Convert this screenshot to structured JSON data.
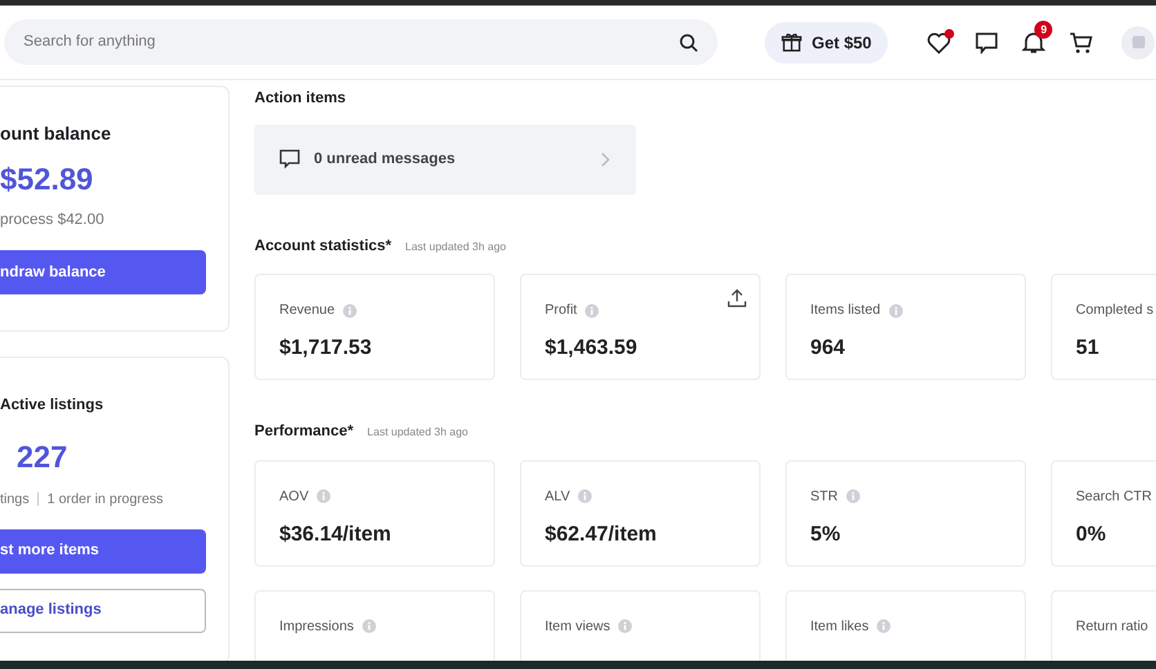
{
  "header": {
    "search": {
      "placeholder": "Search for anything"
    },
    "promo": "Get $50",
    "favorites_dot": true,
    "notifications": "9"
  },
  "balance_card": {
    "title": "ount balance",
    "amount": "$52.89",
    "in_process": "process $42.00",
    "button": "ndraw balance"
  },
  "listings_card": {
    "title": "Active listings",
    "count": "227",
    "stats": [
      "tings",
      "1 order in progress"
    ],
    "buttons": [
      {
        "label": "st more items",
        "kind": "primary"
      },
      {
        "label": "anage listings",
        "kind": "outline"
      }
    ]
  },
  "action_items": {
    "title": "Action items",
    "items": [
      {
        "label": "0 unread messages"
      }
    ]
  },
  "sections": [
    {
      "title": "Account statistics*",
      "updated": "Last updated 3h ago",
      "rows": [
        [
          {
            "label": "Revenue",
            "value": "$1,717.53",
            "info": true,
            "export": false
          },
          {
            "label": "Profit",
            "value": "$1,463.59",
            "info": true,
            "export": true
          },
          {
            "label": "Items listed",
            "value": "964",
            "info": true,
            "export": false
          },
          {
            "label": "Completed s",
            "value": "51",
            "info": false,
            "export": false
          }
        ]
      ]
    },
    {
      "title": "Performance*",
      "updated": "Last updated 3h ago",
      "rows": [
        [
          {
            "label": "AOV",
            "value": "$36.14/item",
            "info": true,
            "export": false
          },
          {
            "label": "ALV",
            "value": "$62.47/item",
            "info": true,
            "export": false
          },
          {
            "label": "STR",
            "value": "5%",
            "info": true,
            "export": false
          },
          {
            "label": "Search CTR",
            "value": "0%",
            "info": false,
            "export": false
          }
        ],
        [
          {
            "label": "Impressions",
            "info": true,
            "export": false
          },
          {
            "label": "Item views",
            "info": true,
            "export": false
          },
          {
            "label": "Item likes",
            "info": true,
            "export": false
          },
          {
            "label": "Return ratio",
            "info": false,
            "export": false
          }
        ]
      ]
    }
  ]
}
